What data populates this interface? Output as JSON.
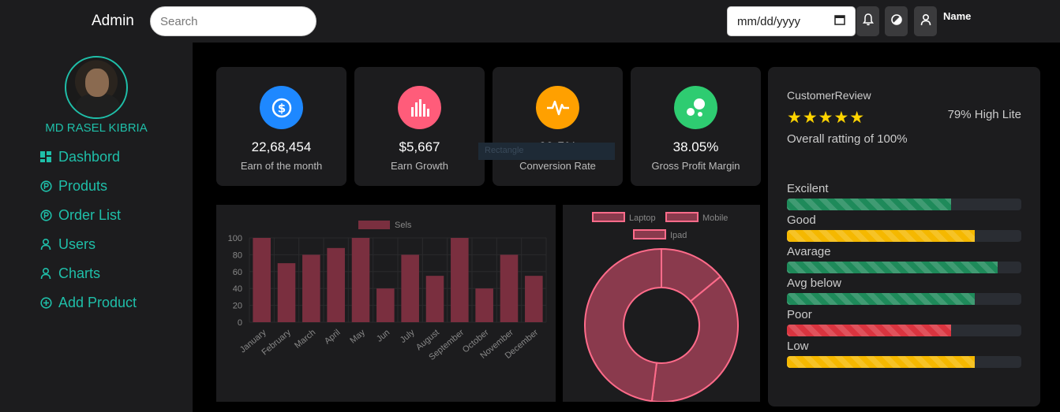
{
  "header": {
    "brand": "Admin",
    "search_placeholder": "Search",
    "date_placeholder": "mm/dd/yyyy",
    "user_label": "Name"
  },
  "sidebar": {
    "username": "MD RASEL KIBRIA",
    "items": [
      {
        "label": "Dashbord",
        "icon": "grid-icon"
      },
      {
        "label": "Produts",
        "icon": "parking-circle-icon"
      },
      {
        "label": "Order List",
        "icon": "parking-circle-icon"
      },
      {
        "label": "Users",
        "icon": "user-icon"
      },
      {
        "label": "Charts",
        "icon": "user-icon"
      },
      {
        "label": "Add Product",
        "icon": "plus-circle-icon"
      }
    ]
  },
  "stats": [
    {
      "value": "22,68,454",
      "label": "Earn of the month",
      "color": "#1e88ff",
      "icon": "dollar-coin-icon"
    },
    {
      "value": "$5,667",
      "label": "Earn Growth",
      "color": "#ff5c7a",
      "icon": "bar-chart-icon"
    },
    {
      "value": "69.5%",
      "label": "Conversion Rate",
      "color": "#ffa000",
      "icon": "pulse-icon"
    },
    {
      "value": "38.05%",
      "label": "Gross Profit Margin",
      "color": "#2ecc71",
      "icon": "bubbles-icon"
    }
  ],
  "ghost_tooltip": "Rectangle",
  "review": {
    "title": "CustomerReview",
    "stars": "★★★★★",
    "percent_text": "79% High Lite",
    "overall_text": "Overall ratting of 100%",
    "bars": [
      {
        "label": "Excilent",
        "value": 0.7,
        "style": "green"
      },
      {
        "label": "Good",
        "value": 0.8,
        "style": "yellow"
      },
      {
        "label": "Avarage",
        "value": 0.9,
        "style": "green"
      },
      {
        "label": "Avg below",
        "value": 0.8,
        "style": "green"
      },
      {
        "label": "Poor",
        "value": 0.7,
        "style": "red"
      },
      {
        "label": "Low",
        "value": 0.8,
        "style": "yellow"
      }
    ]
  },
  "chart_data": [
    {
      "type": "bar",
      "categories": [
        "January",
        "February",
        "March",
        "April",
        "May",
        "Jun",
        "July",
        "August",
        "September",
        "October",
        "November",
        "December"
      ],
      "series": [
        {
          "name": "Sels",
          "values": [
            100,
            70,
            80,
            88,
            100,
            40,
            80,
            55,
            100,
            40,
            80,
            55
          ]
        }
      ],
      "ylim": [
        0,
        100
      ],
      "yticks": [
        0,
        20,
        40,
        60,
        80,
        100
      ],
      "legend": "top",
      "colors": {
        "fill": "#7a2f3f",
        "stroke": "#7a2f3f"
      }
    },
    {
      "type": "pie",
      "categories": [
        "Laptop",
        "Mobile",
        "Ipad"
      ],
      "values": [
        14,
        38,
        48
      ],
      "donut": true,
      "legend": "top",
      "colors": {
        "fill": "#8a3a4d",
        "stroke": "#ff6b8a"
      }
    }
  ]
}
